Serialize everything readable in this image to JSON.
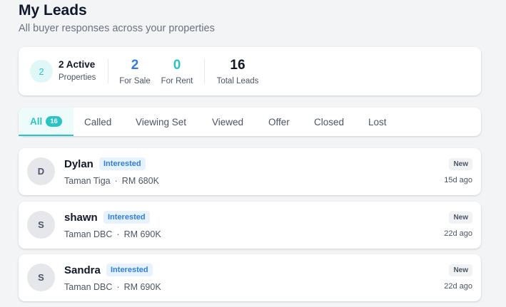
{
  "header": {
    "title": "My Leads",
    "subtitle": "All buyer responses across your properties"
  },
  "stats": {
    "active_count": "2",
    "active_title": "2 Active",
    "active_sub": "Properties",
    "for_sale_value": "2",
    "for_sale_label": "For Sale",
    "for_rent_value": "0",
    "for_rent_label": "For Rent",
    "total_value": "16",
    "total_label": "Total Leads",
    "colors": {
      "for_sale": "#2f7fd8",
      "for_rent": "#2bc4c4",
      "total": "#111827"
    }
  },
  "tabs": [
    {
      "label": "All",
      "count": "16",
      "active": true
    },
    {
      "label": "Called"
    },
    {
      "label": "Viewing Set"
    },
    {
      "label": "Viewed"
    },
    {
      "label": "Offer"
    },
    {
      "label": "Closed"
    },
    {
      "label": "Lost"
    }
  ],
  "leads": [
    {
      "initial": "D",
      "name": "Dylan",
      "status": "Interested",
      "location": "Taman Tiga",
      "separator": "·",
      "price": "RM 680K",
      "badge": "New",
      "time": "15d ago"
    },
    {
      "initial": "S",
      "name": "shawn",
      "status": "Interested",
      "location": "Taman DBC",
      "separator": "·",
      "price": "RM 690K",
      "badge": "New",
      "time": "22d ago"
    },
    {
      "initial": "S",
      "name": "Sandra",
      "status": "Interested",
      "location": "Taman DBC",
      "separator": "·",
      "price": "RM 690K",
      "badge": "New",
      "time": "22d ago"
    }
  ],
  "theme": {
    "accent": "#2bc4c4",
    "badge_blue": "#2f7fd8"
  }
}
